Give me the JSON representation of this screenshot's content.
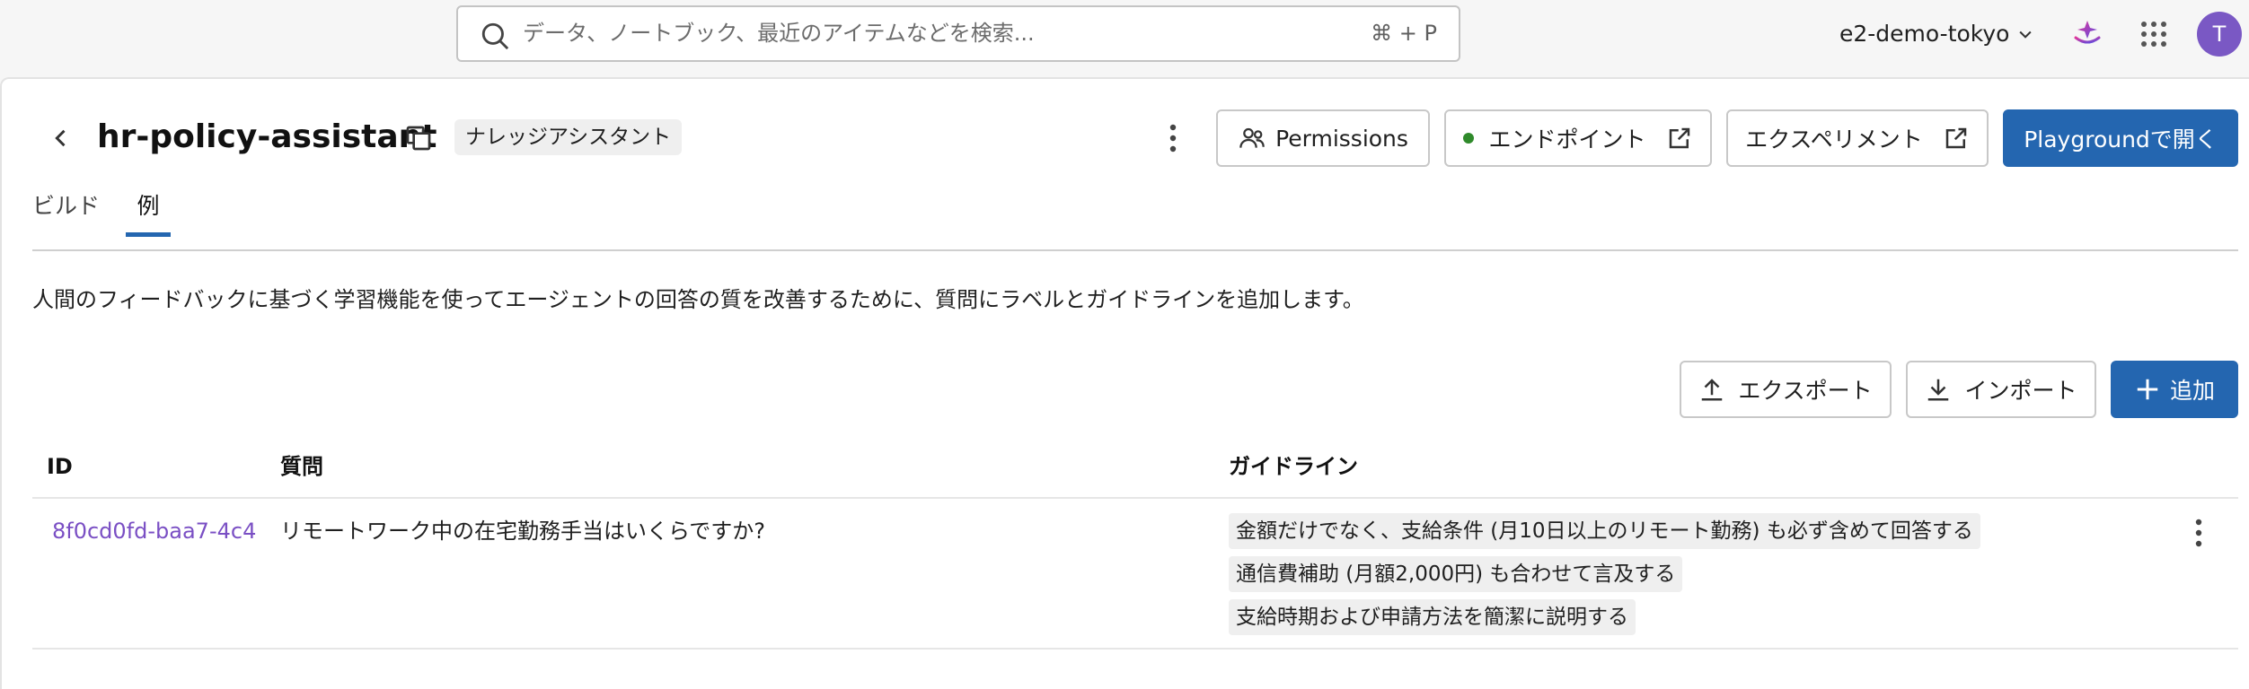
{
  "topbar": {
    "search_placeholder": "データ、ノートブック、最近のアイテムなどを検索...",
    "search_shortcut": "⌘ + P",
    "workspace": "e2-demo-tokyo",
    "avatar_initial": "T"
  },
  "header": {
    "title": "hr-policy-assistant",
    "type_badge": "ナレッジアシスタント",
    "permissions_label": "Permissions",
    "endpoint_label": "エンドポイント",
    "experiment_label": "エクスペリメント",
    "playground_label": "Playgroundで開く"
  },
  "tabs": [
    {
      "label": "ビルド"
    },
    {
      "label": "例"
    }
  ],
  "description": "人間のフィードバックに基づく学習機能を使ってエージェントの回答の質を改善するために、質問にラベルとガイドラインを追加します。",
  "actions": {
    "export_label": "エクスポート",
    "import_label": "インポート",
    "add_label": "追加"
  },
  "table": {
    "columns": [
      "ID",
      "質問",
      "ガイドライン"
    ],
    "rows": [
      {
        "id": "8f0cd0fd-baa7-4c4",
        "question": "リモートワーク中の在宅勤務手当はいくらですか?",
        "guidelines": [
          "金額だけでなく、支給条件 (月10日以上のリモート勤務) も必ず含めて回答する",
          "通信費補助 (月額2,000円) も合わせて言及する",
          "支給時期および申請方法を簡潔に説明する"
        ]
      }
    ]
  },
  "colors": {
    "primary": "#2466b0",
    "link": "#7a4fc4",
    "status_ok": "#2f8a2b",
    "avatar": "#7a58c4"
  }
}
